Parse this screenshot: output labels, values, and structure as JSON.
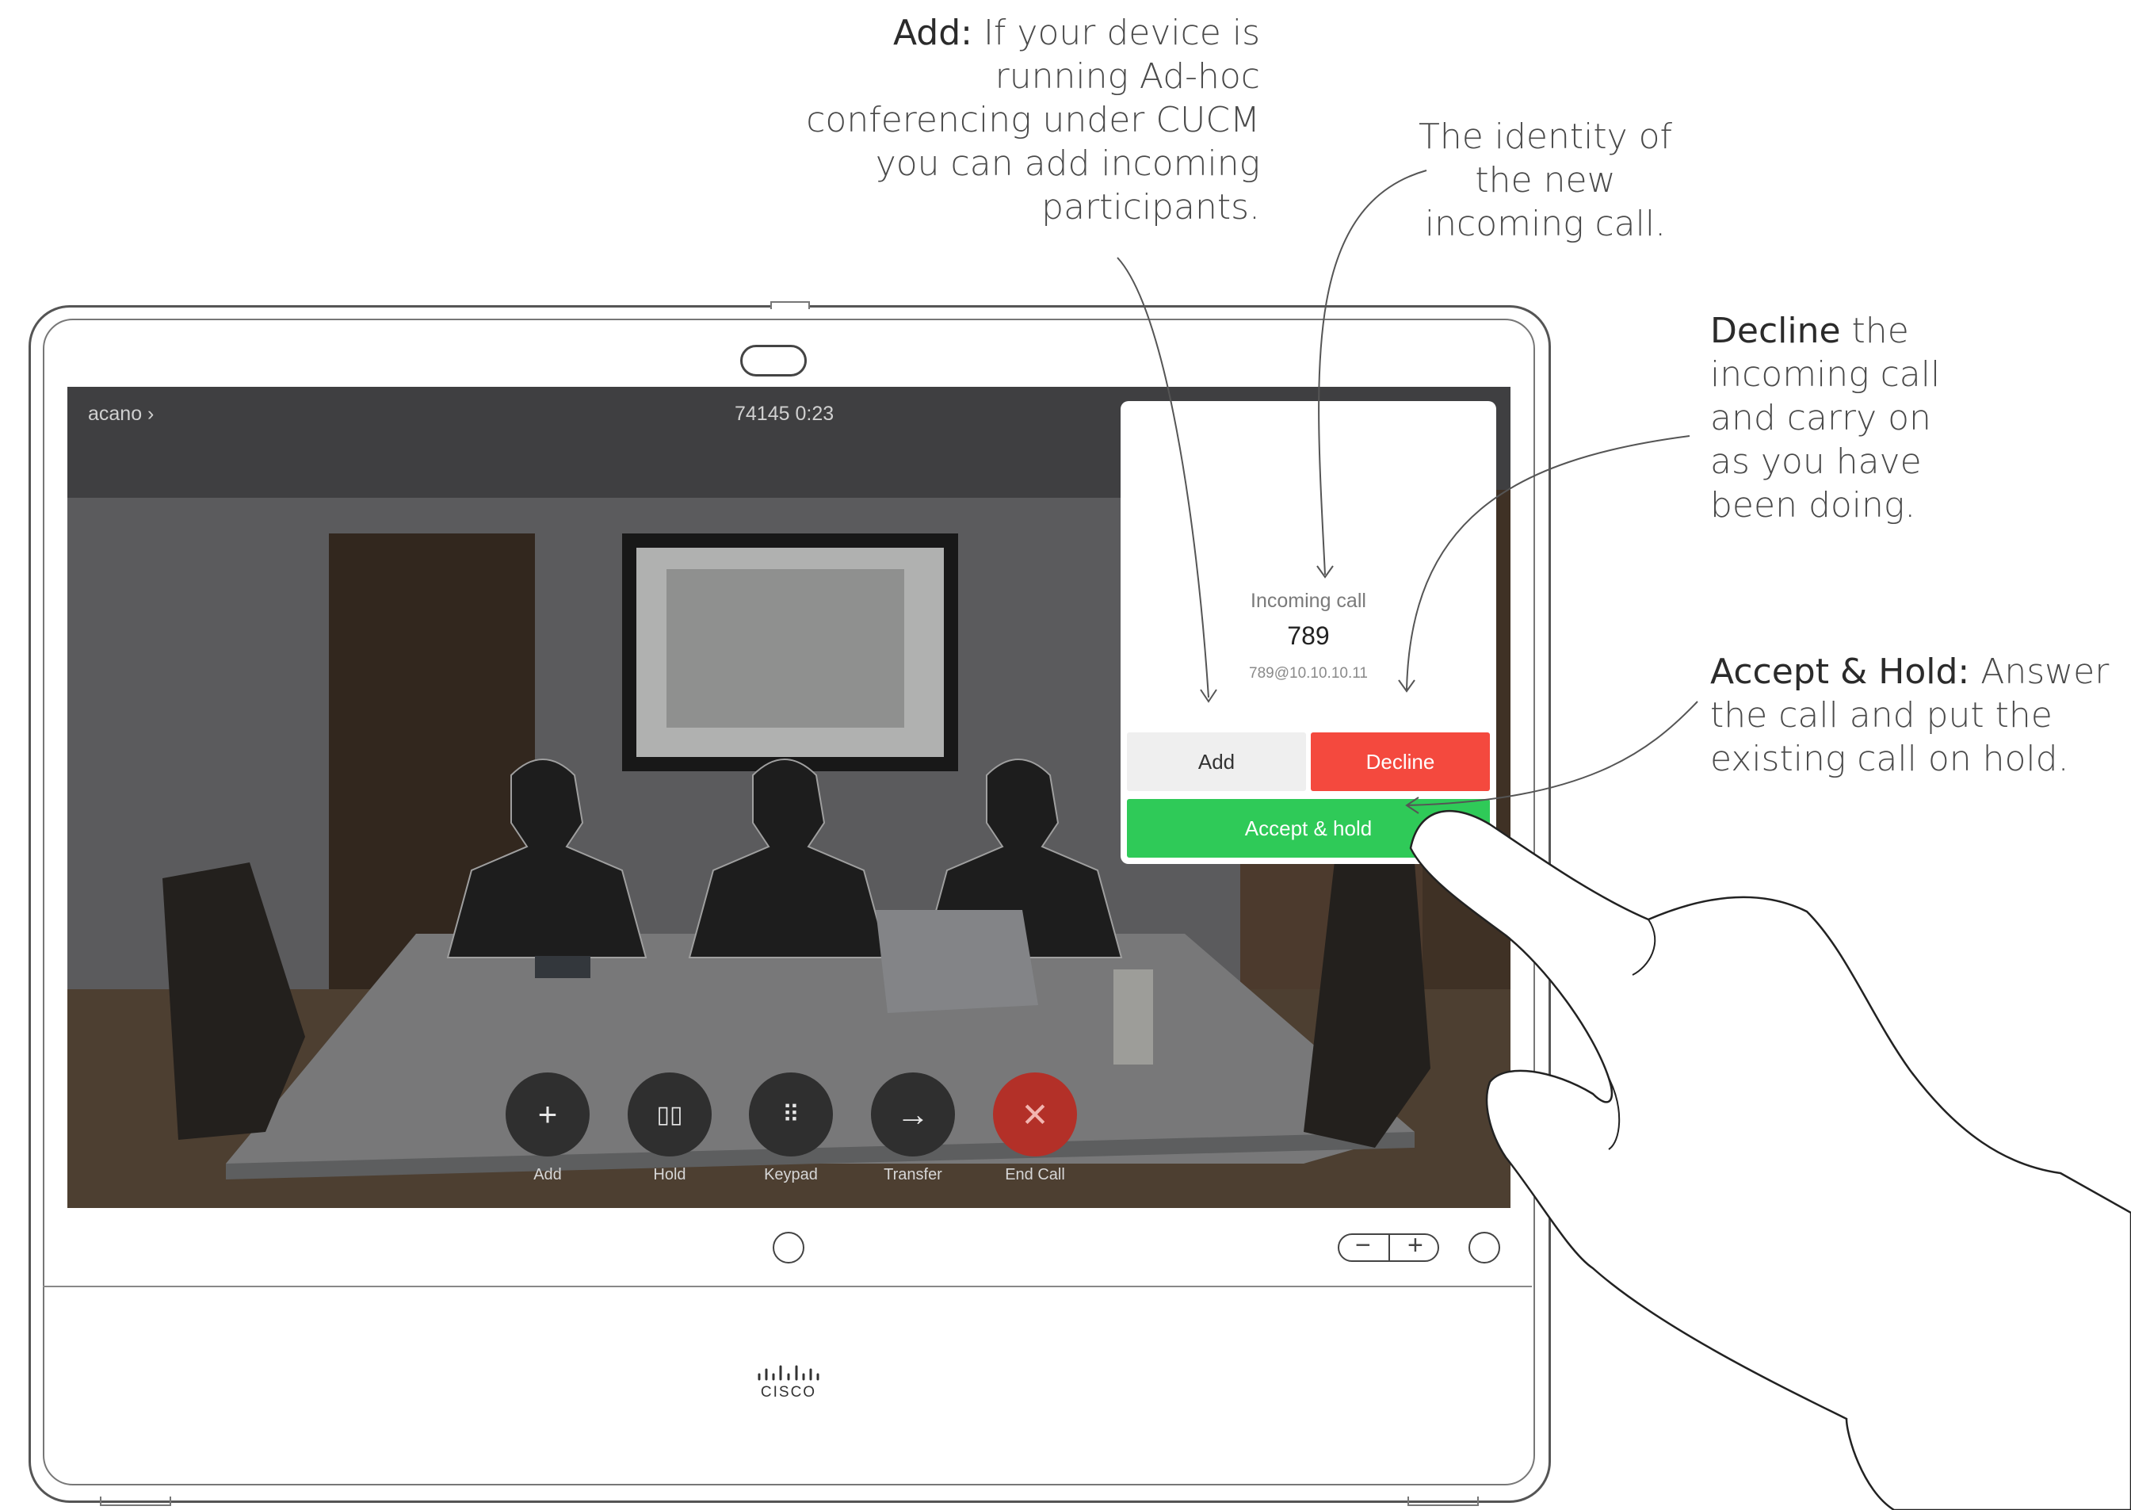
{
  "annotations": {
    "add": {
      "bold": "Add:",
      "text": " If your device is running Ad-hoc conferencing under CUCM you can add incoming participants."
    },
    "identity": {
      "text": "The identity of the new incoming call."
    },
    "decline": {
      "bold": "Decline",
      "text": " the incoming call and carry on as you have been doing."
    },
    "accept": {
      "bold": "Accept & Hold:",
      "text": " Answer the call and put the existing call on hold."
    }
  },
  "screen": {
    "room_name": "acano ›",
    "call_info": "74145  0:23"
  },
  "popup": {
    "title": "Incoming call",
    "caller_name": "789",
    "caller_address": "789@10.10.10.11",
    "add_label": "Add",
    "decline_label": "Decline",
    "accept_label": "Accept & hold",
    "colors": {
      "decline": "#f4493e",
      "accept": "#2fca58"
    }
  },
  "call_controls": [
    {
      "label": "Add",
      "icon": "plus-icon",
      "glyph": "+"
    },
    {
      "label": "Hold",
      "icon": "pause-icon",
      "glyph": "▯▯"
    },
    {
      "label": "Keypad",
      "icon": "keypad-icon",
      "glyph": "⠿"
    },
    {
      "label": "Transfer",
      "icon": "arrow-right-icon",
      "glyph": "→"
    },
    {
      "label": "End Call",
      "icon": "close-icon",
      "glyph": "✕",
      "color": "#b33028"
    }
  ],
  "device": {
    "logo_text": "CISCO"
  }
}
